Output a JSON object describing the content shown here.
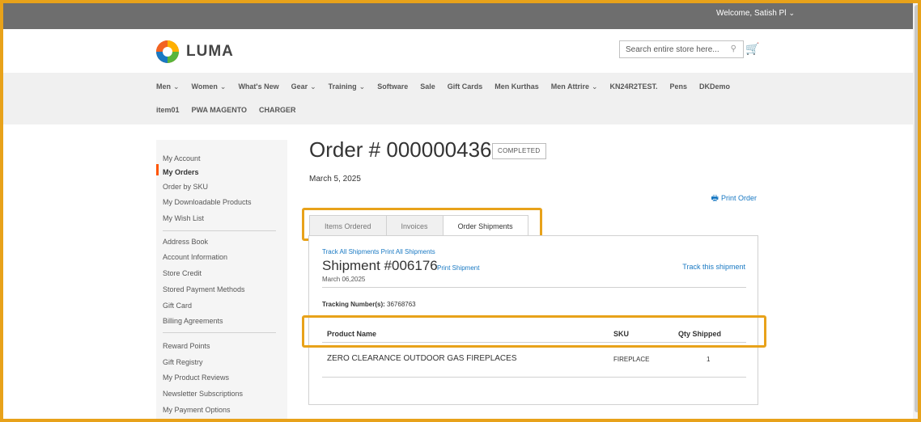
{
  "topbar": {
    "welcome": "Welcome, Satish Pl"
  },
  "header": {
    "logo_text": "LUMA",
    "search_placeholder": "Search entire store here..."
  },
  "nav": {
    "row1": [
      {
        "label": "Men",
        "dropdown": true
      },
      {
        "label": "Women",
        "dropdown": true
      },
      {
        "label": "What's New",
        "dropdown": false
      },
      {
        "label": "Gear",
        "dropdown": true
      },
      {
        "label": "Training",
        "dropdown": true
      },
      {
        "label": "Software",
        "dropdown": false
      },
      {
        "label": "Sale",
        "dropdown": false
      },
      {
        "label": "Gift Cards",
        "dropdown": false
      },
      {
        "label": "Men Kurthas",
        "dropdown": false
      },
      {
        "label": "Men Attrire",
        "dropdown": true
      },
      {
        "label": "KN24R2TEST.",
        "dropdown": false
      },
      {
        "label": "Pens",
        "dropdown": false
      },
      {
        "label": "DKDemo",
        "dropdown": false
      }
    ],
    "row2": [
      {
        "label": "item01"
      },
      {
        "label": "PWA MAGENTO"
      },
      {
        "label": "CHARGER"
      }
    ]
  },
  "sidebar": {
    "items": [
      "My Account",
      "My Orders",
      "Order by SKU",
      "My Downloadable Products",
      "My Wish List",
      "Address Book",
      "Account Information",
      "Store Credit",
      "Stored Payment Methods",
      "Gift Card",
      "Billing Agreements",
      "Reward Points",
      "Gift Registry",
      "My Product Reviews",
      "Newsletter Subscriptions",
      "My Payment Options"
    ],
    "active": "My Orders"
  },
  "order": {
    "title": "Order # 000000436",
    "status": "COMPLETED",
    "date": "March 5, 2025",
    "print_order": "Print Order"
  },
  "tabs": [
    "Items Ordered",
    "Invoices",
    "Order Shipments"
  ],
  "shipment": {
    "track_all": "Track All Shipments",
    "print_all": "Print All Shipments",
    "title": "Shipment #006176",
    "print_shipment": "Print Shipment",
    "track_this": "Track this shipment",
    "date": "March 06,2025",
    "tracking_label": "Tracking Number(s):",
    "tracking_number": "36768763",
    "columns": [
      "Product Name",
      "SKU",
      "Qty Shipped"
    ],
    "rows": [
      {
        "product": "ZERO CLEARANCE OUTDOOR GAS FIREPLACES",
        "sku": "FIREPLACE",
        "qty": "1"
      }
    ]
  },
  "colors": {
    "accent": "#1979c3",
    "highlight": "#e8a21a",
    "active_bar": "#ff5501"
  }
}
